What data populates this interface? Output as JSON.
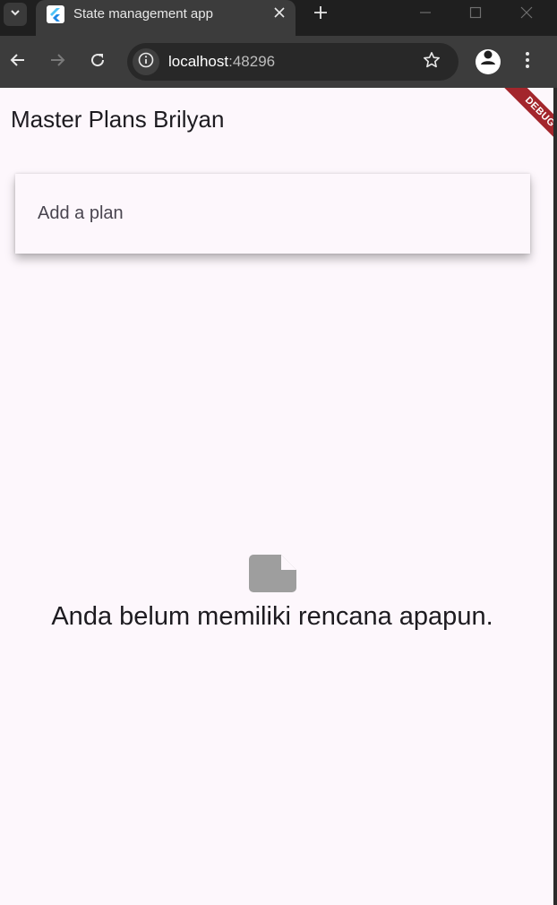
{
  "browser": {
    "tab_title": "State management app",
    "url_host": "localhost",
    "url_port": ":48296"
  },
  "app": {
    "title": "Master Plans Brilyan",
    "debug_banner": "DEBUG",
    "input_placeholder": "Add a plan",
    "empty_message": "Anda belum memiliki rencana apapun.",
    "empty_icon": "note-icon"
  },
  "colors": {
    "page_background": "#fdf7fc",
    "debug_banner": "#a3262c",
    "empty_icon": "#9e9e9e",
    "browser_chrome": "#3c3c3c"
  }
}
